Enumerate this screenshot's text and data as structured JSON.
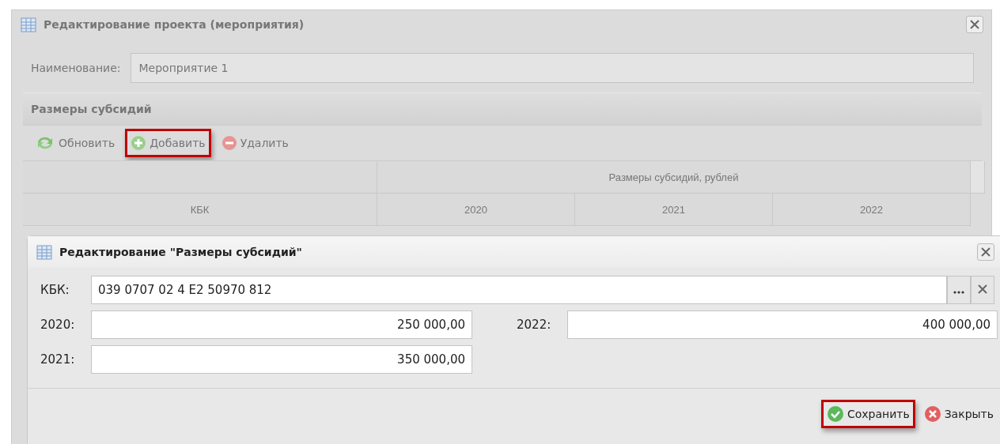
{
  "window": {
    "title": "Редактирование проекта (мероприятия)",
    "masked": true
  },
  "name_field": {
    "label": "Наименование:",
    "value": "Мероприятие 1"
  },
  "section": {
    "title": "Размеры субсидий"
  },
  "toolbar": [
    {
      "kind": "refresh",
      "label": "Обновить",
      "highlighted": false
    },
    {
      "kind": "add",
      "label": "Добавить",
      "highlighted": true
    },
    {
      "kind": "delete",
      "label": "Удалить",
      "highlighted": false
    }
  ],
  "table": {
    "group_header": "Размеры субсидий, рублей",
    "columns": [
      "КБК",
      "2020",
      "2021",
      "2022"
    ]
  },
  "dialog": {
    "title": "Редактирование \"Размеры субсидий\"",
    "kbk": {
      "label": "КБК:",
      "value": "039 0707 02 4 E2 50970 812"
    },
    "fields": [
      {
        "label": "2020:",
        "value": "250 000,00"
      },
      {
        "label": "2021:",
        "value": "350 000,00"
      }
    ],
    "right_fields": [
      {
        "label": "2022:",
        "value": "400 000,00"
      }
    ],
    "buttons": [
      {
        "kind": "save",
        "label": "Сохранить",
        "highlighted": true
      },
      {
        "kind": "close",
        "label": "Закрыть",
        "highlighted": false
      }
    ]
  }
}
